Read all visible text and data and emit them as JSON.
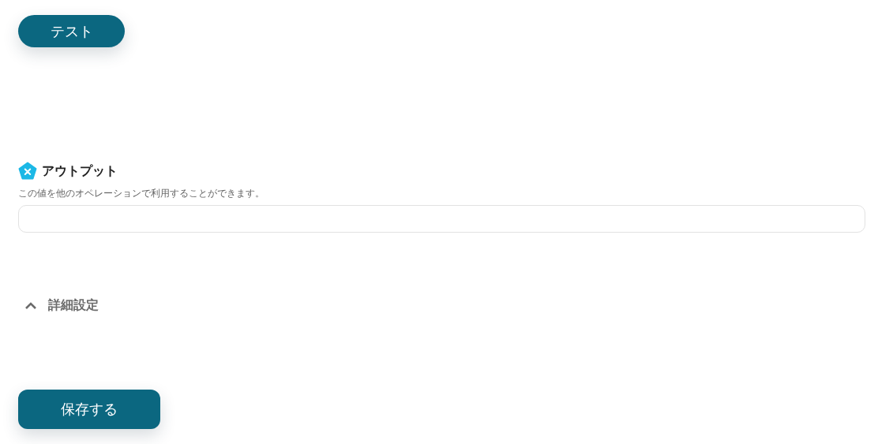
{
  "test_button": {
    "label": "テスト"
  },
  "output": {
    "title": "アウトプット",
    "description": "この値を他のオペレーションで利用することができます。"
  },
  "advanced_settings": {
    "label": "詳細設定"
  },
  "save_button": {
    "label": "保存する"
  }
}
